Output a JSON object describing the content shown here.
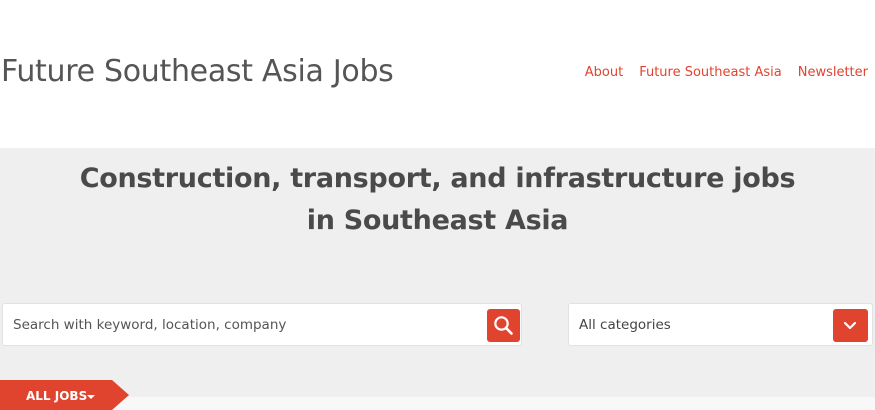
{
  "header": {
    "site_title": "Future Southeast Asia Jobs",
    "nav": [
      {
        "label": "About"
      },
      {
        "label": "Future Southeast Asia"
      },
      {
        "label": "Newsletter"
      }
    ]
  },
  "hero": {
    "headline_line1": "Construction, transport, and infrastructure jobs",
    "headline_line2": "in Southeast Asia"
  },
  "search": {
    "placeholder": "Search with keyword, location, company",
    "value": "",
    "button_icon": "search-icon"
  },
  "category": {
    "selected": "All categories",
    "button_icon": "chevron-down-icon"
  },
  "tabs": {
    "all_jobs_label": "ALL JOBS",
    "all_jobs_icon": "caret-down-icon"
  },
  "colors": {
    "accent": "#e0442f",
    "title_text": "#555555",
    "hero_background": "#efefef"
  }
}
